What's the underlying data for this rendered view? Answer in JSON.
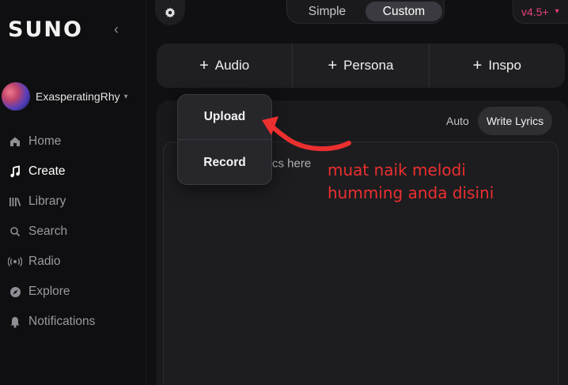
{
  "sidebar": {
    "logo": "SUNO",
    "collapse_icon": "chevron-left-icon",
    "user": {
      "name": "ExasperatingRhy"
    },
    "items": [
      {
        "label": "Home",
        "icon": "home-icon",
        "active": false
      },
      {
        "label": "Create",
        "icon": "music-note-icon",
        "active": true
      },
      {
        "label": "Library",
        "icon": "library-icon",
        "active": false
      },
      {
        "label": "Search",
        "icon": "search-icon",
        "active": false
      },
      {
        "label": "Radio",
        "icon": "radio-icon",
        "active": false
      },
      {
        "label": "Explore",
        "icon": "compass-icon",
        "active": false
      },
      {
        "label": "Notifications",
        "icon": "bell-icon",
        "active": false
      }
    ]
  },
  "topbar": {
    "settings_icon": "gear-icon",
    "modes": [
      "Simple",
      "Custom"
    ],
    "selected_mode": "Custom",
    "version": "v4.5+"
  },
  "add_buttons": [
    "Audio",
    "Persona",
    "Inspo"
  ],
  "lyrics": {
    "modes": {
      "auto": "Auto",
      "write": "Write Lyrics"
    },
    "visible_hint": "cs here"
  },
  "dropdown": {
    "items": [
      "Upload",
      "Record"
    ]
  },
  "annotation": {
    "line1": "muat naik melodi",
    "line2": "humming anda disini"
  },
  "colors": {
    "accent": "#e7407a",
    "annotation": "#ec2f2f",
    "background": "#101012"
  }
}
